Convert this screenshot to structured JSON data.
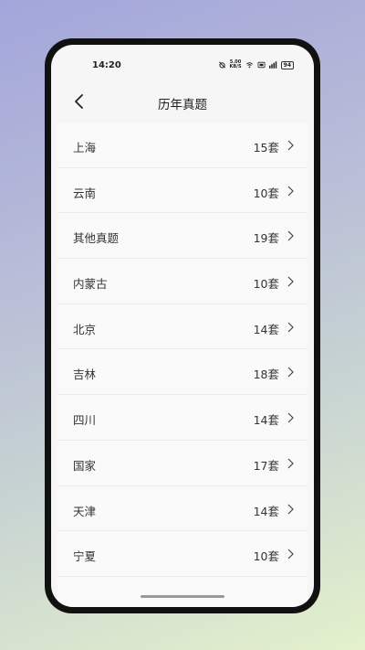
{
  "status_bar": {
    "time": "14:20",
    "net_speed_value": "5.00",
    "net_speed_unit": "KB/S",
    "battery": "94",
    "icons": [
      "alarm-muted-icon",
      "wifi-icon",
      "hd-icon",
      "signal-icon",
      "battery-icon"
    ]
  },
  "header": {
    "title": "历年真题",
    "back_icon": "chevron-left-icon"
  },
  "list": {
    "items": [
      {
        "name": "上海",
        "count": "15套"
      },
      {
        "name": "云南",
        "count": "10套"
      },
      {
        "name": "其他真题",
        "count": "19套"
      },
      {
        "name": "内蒙古",
        "count": "10套"
      },
      {
        "name": "北京",
        "count": "14套"
      },
      {
        "name": "吉林",
        "count": "18套"
      },
      {
        "name": "四川",
        "count": "14套"
      },
      {
        "name": "国家",
        "count": "17套"
      },
      {
        "name": "天津",
        "count": "14套"
      },
      {
        "name": "宁夏",
        "count": "10套"
      }
    ],
    "chevron_icon": "chevron-right-icon"
  },
  "colors": {
    "background_top": "#a3a6da",
    "background_bottom": "#e4f1cc",
    "screen": "#f6f6f6",
    "text": "#333333"
  }
}
